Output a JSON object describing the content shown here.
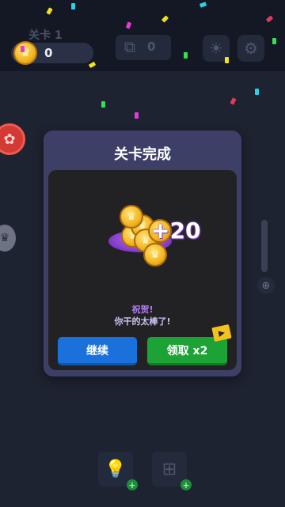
{
  "hud": {
    "level_label": "关卡 1",
    "coins": "0",
    "hints": "0",
    "icons": {
      "coin": "crown-coin-icon",
      "hint": "hint-tool-icon",
      "theme": "sun-icon",
      "settings": "gear-icon"
    }
  },
  "side": {
    "left_top_icon": "flower-icon",
    "left_mid_icon": "trophy-icon",
    "zoom_icon": "zoom-in-icon"
  },
  "modal": {
    "title": "关卡完成",
    "reward_amount": "+20",
    "congrats": "祝贺!",
    "praise": "你干的太棒了!",
    "continue_label": "继续",
    "claim_label": "领取 x2",
    "ad_icon": "clapperboard-icon"
  },
  "bottom_tools": [
    {
      "icon": "lightbulb-icon",
      "badge": "+"
    },
    {
      "icon": "grid-cross-icon",
      "badge": "+"
    }
  ],
  "colors": {
    "background": "#1e2331",
    "modal": "#3d3f67",
    "continue": "#1a71db",
    "claim": "#1da335",
    "accent_purple": "#8a3fd1"
  }
}
